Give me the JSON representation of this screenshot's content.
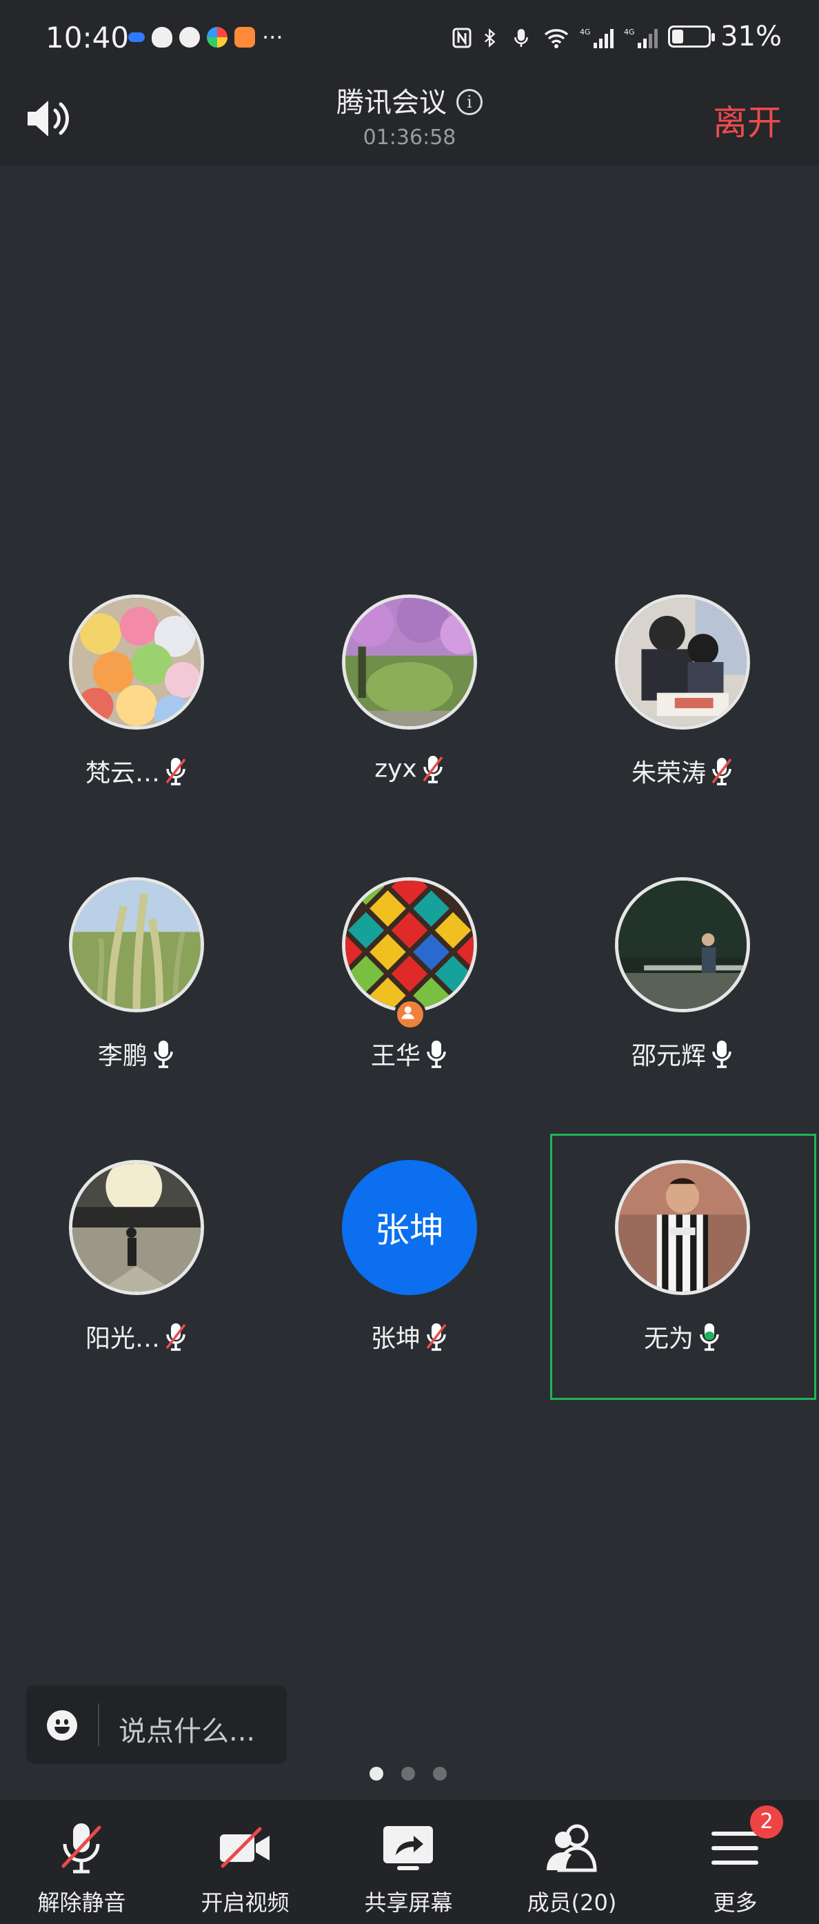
{
  "status_bar": {
    "time": "10:40",
    "battery_level": 0.31,
    "battery_percent": "31%"
  },
  "header": {
    "title": "腾讯会议",
    "duration": "01:36:58",
    "leave_label": "离开"
  },
  "participants": [
    {
      "name": "梵云…",
      "mic": "muted",
      "avatar": "candy-photo"
    },
    {
      "name": "zyx",
      "mic": "muted",
      "avatar": "flower-bush-photo"
    },
    {
      "name": "朱荣涛",
      "mic": "muted",
      "avatar": "father-son-photo"
    },
    {
      "name": "李鹏",
      "mic": "on",
      "avatar": "wheat-photo"
    },
    {
      "name": "王华",
      "mic": "on",
      "avatar": "colorful-tiles",
      "host": true
    },
    {
      "name": "邵元辉",
      "mic": "on",
      "avatar": "night-person-photo"
    },
    {
      "name": "阳光…",
      "mic": "muted",
      "avatar": "sunset-person-photo"
    },
    {
      "name": "张坤",
      "mic": "muted",
      "avatar_text": "张坤"
    },
    {
      "name": "无为",
      "mic": "speaking",
      "avatar": "football-player-photo",
      "active": true
    }
  ],
  "chat": {
    "placeholder": "说点什么..."
  },
  "pagination": {
    "pages": 3,
    "current": 1
  },
  "toolbar": {
    "unmute_label": "解除静音",
    "video_label": "开启视频",
    "share_label": "共享屏幕",
    "members_label": "成员(20)",
    "more_label": "更多",
    "more_badge": "2"
  },
  "colors": {
    "background": "#2a2d31",
    "leave": "#ec4b4b",
    "accent_blue": "#0b6fef",
    "speaking_green": "#21b35a",
    "badge_red": "#ee4444"
  }
}
